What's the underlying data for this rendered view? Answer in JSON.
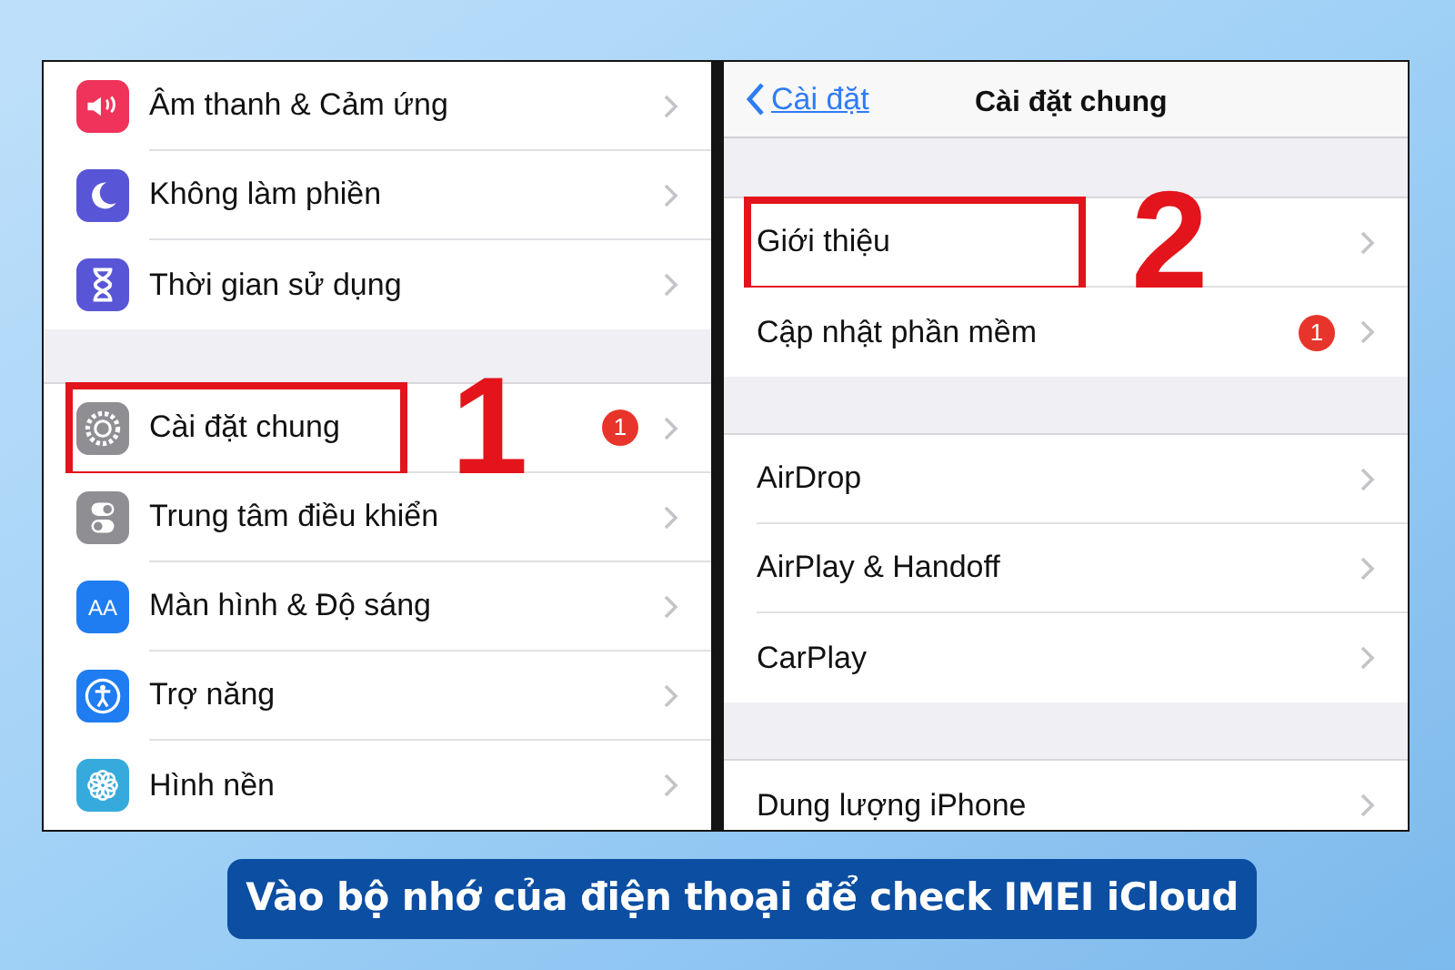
{
  "left_screen": {
    "groups": [
      {
        "items": [
          {
            "label": "Âm thanh & Cảm ứng",
            "kind": "sound",
            "highlighted": false
          },
          {
            "label": "Không làm phiền",
            "kind": "moon",
            "highlighted": false
          },
          {
            "label": "Thời gian sử dụng",
            "kind": "hourglass",
            "highlighted": false
          }
        ]
      },
      {
        "items": [
          {
            "label": "Cài đặt chung",
            "kind": "gear",
            "badge": "1",
            "highlighted": true,
            "callout": "1"
          },
          {
            "label": "Trung tâm điều khiển",
            "kind": "switches",
            "highlighted": false
          },
          {
            "label": "Màn hình & Độ sáng",
            "kind": "text-size",
            "icon_text": "AA",
            "highlighted": false
          },
          {
            "label": "Trợ năng",
            "kind": "accessibility",
            "highlighted": false
          },
          {
            "label": "Hình nền",
            "kind": "flower",
            "highlighted": false
          }
        ]
      }
    ]
  },
  "right_screen": {
    "nav": {
      "back": "Cài đặt",
      "title": "Cài đặt chung"
    },
    "groups": [
      {
        "items": [
          {
            "label": "Giới thiệu",
            "highlighted": true,
            "callout": "2"
          },
          {
            "label": "Cập nhật phần mềm",
            "badge": "1",
            "highlighted": false
          }
        ]
      },
      {
        "items": [
          {
            "label": "AirDrop",
            "highlighted": false
          },
          {
            "label": "AirPlay & Handoff",
            "highlighted": false
          },
          {
            "label": "CarPlay",
            "highlighted": false
          }
        ]
      },
      {
        "items": [
          {
            "label": "Dung lượng iPhone",
            "highlighted": false
          }
        ]
      }
    ]
  },
  "caption": "Vào bộ nhớ của điện thoại để check IMEI iCloud"
}
